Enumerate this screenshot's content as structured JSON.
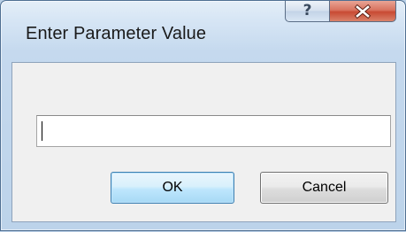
{
  "window": {
    "title": "Enter Parameter Value"
  },
  "caption_buttons": {
    "help_glyph": "?",
    "help_icon": "help-icon",
    "close_icon": "close-icon"
  },
  "dialog": {
    "input_value": "",
    "ok_label": "OK",
    "cancel_label": "Cancel"
  },
  "colors": {
    "frame": "#bcd3ea",
    "close_button": "#c84a33",
    "default_button_border": "#3c7fb1"
  }
}
